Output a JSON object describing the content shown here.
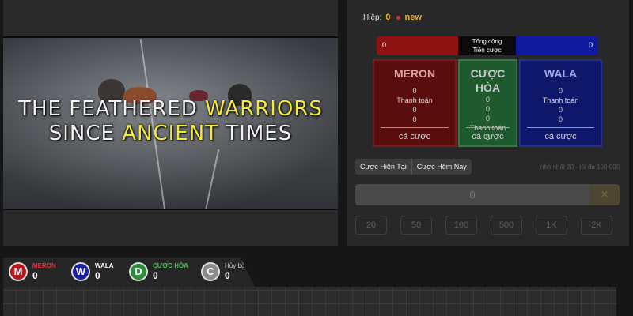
{
  "video": {
    "caption_line1_pre": "THE FEATHERED ",
    "caption_line1_highlight": "WARRIORS",
    "caption_line2_pre": "SINCE ",
    "caption_line2_highlight": "ANCIENT",
    "caption_line2_post": " TIMES"
  },
  "round": {
    "label": "Hiệp:",
    "number": "0",
    "status": "new"
  },
  "totals": {
    "meron_total": "0",
    "label_line1": "Tổng cộng",
    "label_line2": "Tiền cược",
    "wala_total": "0"
  },
  "bet_boxes": {
    "meron": {
      "title": "MERON",
      "value1": "0",
      "payout_label": "Thanh toán",
      "value2": "0",
      "value3": "0",
      "cta": "cá cược"
    },
    "hoa": {
      "title_line1": "CƯỢC",
      "title_line2": "HÒA",
      "value1": "0",
      "value2": "0",
      "value3": "0",
      "payout_label": "Thanh toán",
      "value4": "8",
      "cta": "cá cược"
    },
    "wala": {
      "title": "WALA",
      "value1": "0",
      "payout_label": "Thanh toán",
      "value2": "0",
      "value3": "0",
      "cta": "cá cược"
    }
  },
  "tabs": [
    "Cược Hiện Tại",
    "Cược Hôm Nay"
  ],
  "limits_text": "nhỏ nhất 20 - tối đa 100,000",
  "amount": {
    "value": "0",
    "clear_icon": "close-icon",
    "clear_symbol": "✕"
  },
  "chips": [
    "20",
    "50",
    "100",
    "500",
    "1K",
    "2K"
  ],
  "tally": [
    {
      "letter": "M",
      "name": "MERON",
      "count": "0",
      "color": "#e0353a"
    },
    {
      "letter": "W",
      "name": "WALA",
      "count": "0",
      "color": "#ffffff"
    },
    {
      "letter": "D",
      "name": "CƯỢC HÒA",
      "count": "0",
      "color": "#3fbf55"
    },
    {
      "letter": "C",
      "name": "Hủy bỏ",
      "count": "0",
      "color": "#cfcfcf"
    }
  ],
  "colors": {
    "meron": "#8f1212",
    "wala": "#101a9e",
    "hoa": "#1f5a2e",
    "accent": "#f0b41e",
    "highlight": "#f3ea3a"
  }
}
